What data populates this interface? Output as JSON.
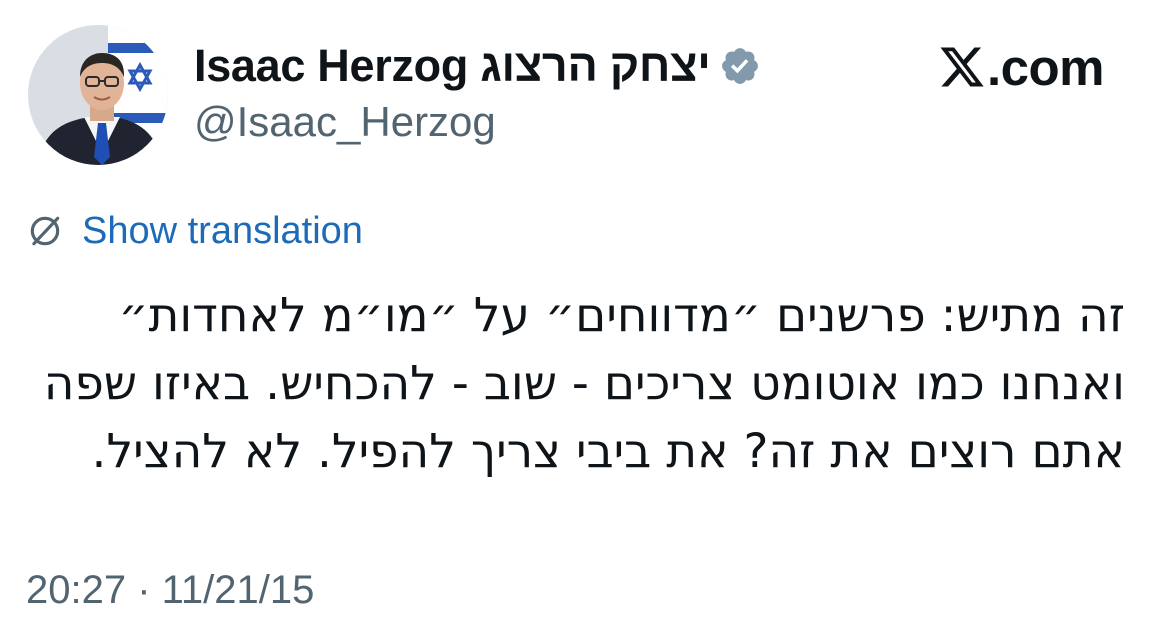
{
  "author": {
    "display_name": "Isaac Herzog יצחק הרצוג",
    "handle": "@Isaac_Herzog",
    "verified_icon": "verified-badge-icon"
  },
  "site": {
    "logo_text": ".com",
    "logo_icon": "x-logo-icon"
  },
  "translate": {
    "label": "Show translation",
    "icon": "globe-slash-icon"
  },
  "tweet": {
    "lines": [
      "זה מתיש: פרשנים ״מדווחים״ על ״מו״מ לאחדות״",
      "ואנחנו כמו אוטומט צריכים - שוב - להכחיש. באיזו שפה",
      "אתם רוצים את זה? את ביבי צריך להפיל. לא להציל."
    ]
  },
  "meta": {
    "timestamp": "20:27 · 11/21/15"
  },
  "colors": {
    "text": "#0f1419",
    "secondary": "#536471",
    "link": "#1d6bb8",
    "badge": "#829aab"
  }
}
